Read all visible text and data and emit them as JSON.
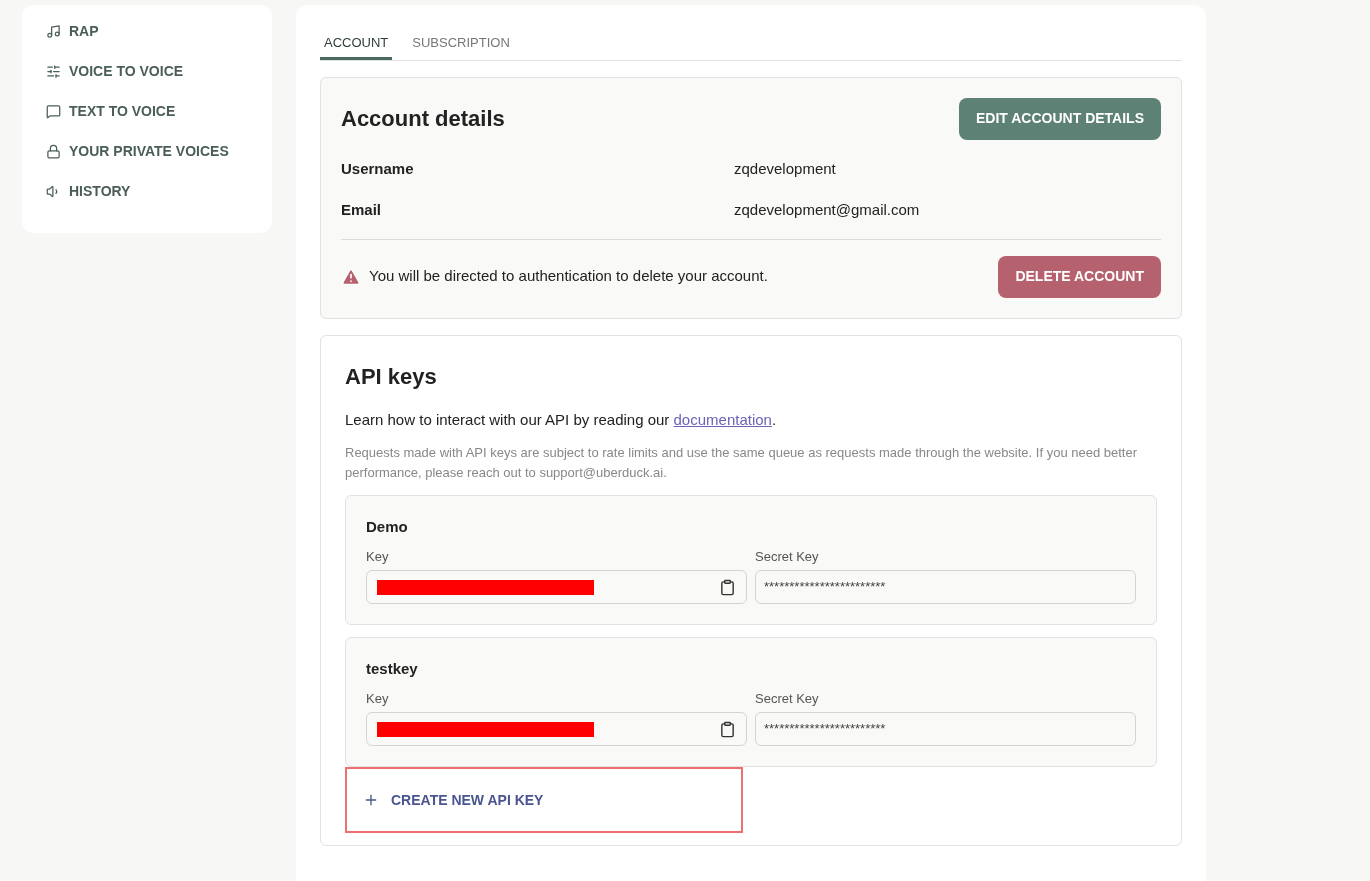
{
  "sidebar": {
    "items": [
      {
        "label": "RAP"
      },
      {
        "label": "VOICE TO VOICE"
      },
      {
        "label": "TEXT TO VOICE"
      },
      {
        "label": "YOUR PRIVATE VOICES"
      },
      {
        "label": "HISTORY"
      }
    ]
  },
  "tabs": [
    {
      "label": "ACCOUNT",
      "selected": true
    },
    {
      "label": "SUBSCRIPTION",
      "selected": false
    }
  ],
  "account": {
    "title": "Account details",
    "edit_button": "EDIT ACCOUNT DETAILS",
    "fields": [
      {
        "label": "Username",
        "value": "zqdevelopment"
      },
      {
        "label": "Email",
        "value": "zqdevelopment@gmail.com"
      }
    ],
    "warning": "You will be directed to authentication to delete your account.",
    "delete_button": "DELETE ACCOUNT"
  },
  "api": {
    "title": "API keys",
    "intro": "Learn how to interact with our API by reading our",
    "link": "documentation",
    "intro_end": ".",
    "note": "Requests made with API keys are subject to rate limits and use the same queue as requests made through the website. If you need better performance, please reach out to support@uberduck.ai.",
    "keys": [
      {
        "name": "Demo",
        "key_label": "Key",
        "secret_label": "Secret Key",
        "secret": "************************"
      },
      {
        "name": "testkey",
        "key_label": "Key",
        "secret_label": "Secret Key",
        "secret": "************************"
      }
    ],
    "create_button": {
      "label": "CREATE NEW API KEY",
      "highlighted": true
    }
  }
}
